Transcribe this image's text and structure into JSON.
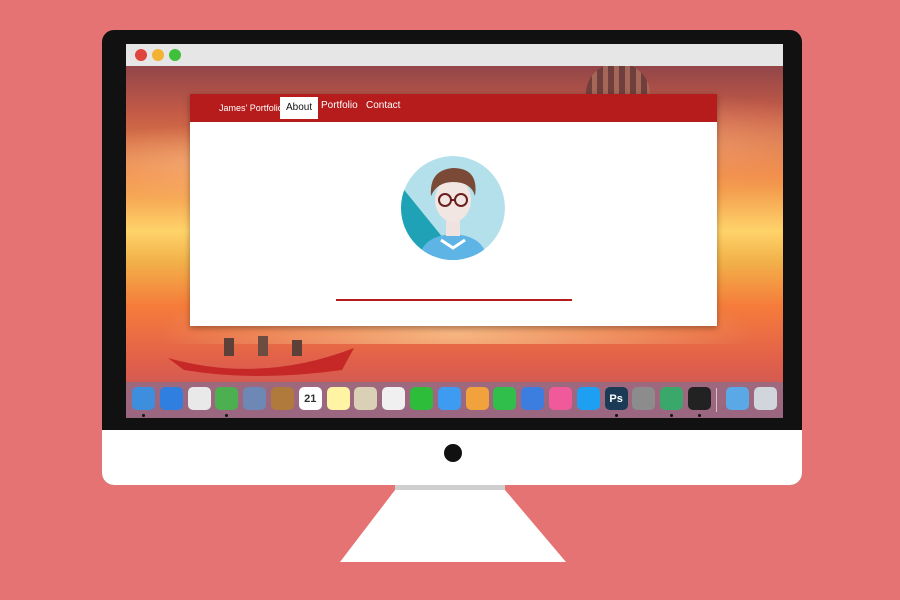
{
  "window": {
    "controls": [
      "close",
      "minimize",
      "zoom"
    ]
  },
  "site": {
    "brand": "James' Portfolio",
    "nav": [
      {
        "label": "About",
        "active": true
      },
      {
        "label": "Portfolio",
        "active": false
      },
      {
        "label": "Contact",
        "active": false
      }
    ]
  },
  "dock": {
    "apps": [
      {
        "icon": "finder-icon",
        "color": "#3e8ede",
        "running": true
      },
      {
        "icon": "safari-icon",
        "color": "#2f7fe0",
        "running": false
      },
      {
        "icon": "launchpad-icon",
        "color": "#e9e9e9",
        "running": false
      },
      {
        "icon": "chrome-icon",
        "color": "#4caf50",
        "running": true
      },
      {
        "icon": "preview-icon",
        "color": "#6e88b5",
        "running": false
      },
      {
        "icon": "contacts-icon",
        "color": "#b07a3d",
        "running": false
      },
      {
        "icon": "calendar-icon",
        "color": "#ffffff",
        "running": false,
        "text": "21"
      },
      {
        "icon": "notes-icon",
        "color": "#fff4a3",
        "running": false
      },
      {
        "icon": "preview-photos-icon",
        "color": "#d9d0b5",
        "running": false
      },
      {
        "icon": "photos-icon",
        "color": "#f0f0f0",
        "running": false
      },
      {
        "icon": "facetime-icon",
        "color": "#2ebd3b",
        "running": false
      },
      {
        "icon": "messages-icon",
        "color": "#3d9bf2",
        "running": false
      },
      {
        "icon": "pages-icon",
        "color": "#f2a23d",
        "running": false
      },
      {
        "icon": "numbers-icon",
        "color": "#2fbf4a",
        "running": false
      },
      {
        "icon": "keynote-icon",
        "color": "#3b7ee0",
        "running": false
      },
      {
        "icon": "itunes-icon",
        "color": "#f05a9a",
        "running": false
      },
      {
        "icon": "app-store-icon",
        "color": "#1ea0f2",
        "running": false
      },
      {
        "icon": "photoshop-icon",
        "color": "#1b3a55",
        "running": true,
        "text": "Ps"
      },
      {
        "icon": "system-preferences-icon",
        "color": "#8c8c8c",
        "running": false
      },
      {
        "icon": "atom-icon",
        "color": "#3aa86b",
        "running": true
      },
      {
        "icon": "terminal-icon",
        "color": "#222222",
        "running": true
      },
      {
        "icon": "downloads-folder-icon",
        "color": "#5aa9e6",
        "running": false
      },
      {
        "icon": "trash-icon",
        "color": "#d0d6db",
        "running": false
      }
    ]
  },
  "colors": {
    "background": "#e57373",
    "nav": "#b71c1c",
    "accent_line": "#b71c1c"
  }
}
